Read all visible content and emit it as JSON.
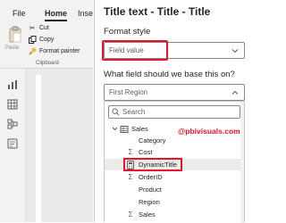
{
  "ribbon": {
    "tabs": [
      "File",
      "Home",
      "Insert"
    ],
    "paste_label": "Paste",
    "cut_label": "Cut",
    "copy_label": "Copy",
    "format_painter_label": "Format painter",
    "group_label": "Clipboard"
  },
  "pane": {
    "title": "Title text - Title - Title",
    "format_style_label": "Format style",
    "format_style_value": "Field value",
    "field_question": "What field should we base this on?",
    "field_value": "First Region",
    "search_placeholder": "Search",
    "watermark": "@pbivisuals.com",
    "highlight_color": "#e3142b"
  },
  "field_list": {
    "table": "Sales",
    "fields": [
      {
        "label": "Category",
        "icon": ""
      },
      {
        "label": "Cost",
        "icon": "sigma-icon"
      },
      {
        "label": "DynamicTitle",
        "icon": "calculator-icon"
      },
      {
        "label": "OrderID",
        "icon": "sigma-icon"
      },
      {
        "label": "Product",
        "icon": ""
      },
      {
        "label": "Region",
        "icon": ""
      },
      {
        "label": "Sales",
        "icon": "sigma-icon"
      }
    ]
  }
}
